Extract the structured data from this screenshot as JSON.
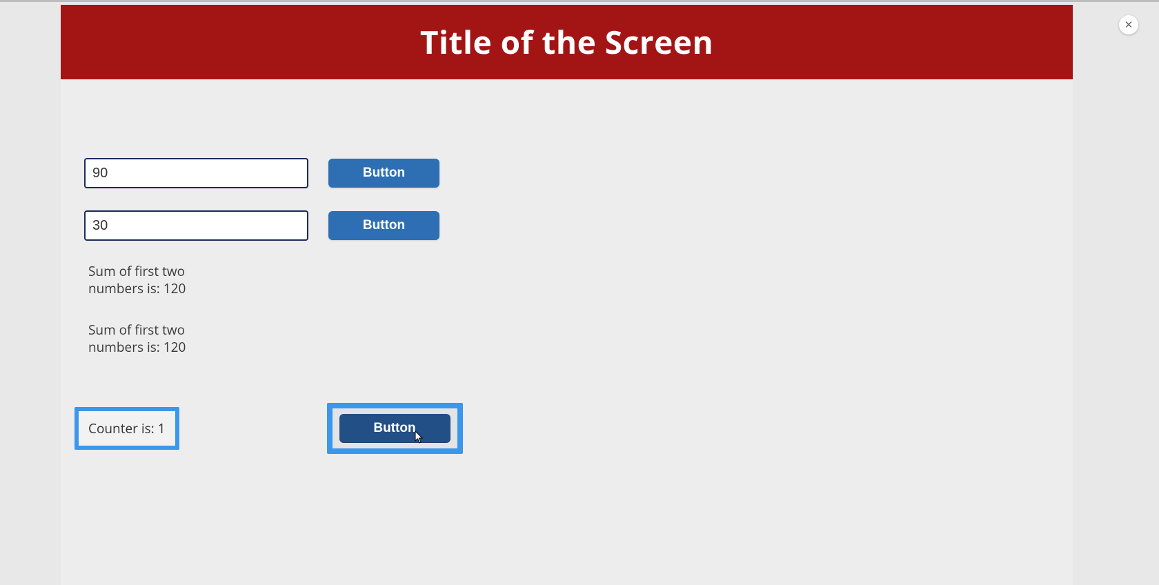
{
  "header": {
    "title": "Title of the Screen"
  },
  "close": {
    "glyph": "✕"
  },
  "inputs": {
    "first": {
      "value": "90"
    },
    "second": {
      "value": "30"
    }
  },
  "buttons": {
    "first_label": "Button",
    "second_label": "Button",
    "counter_label": "Button"
  },
  "sums": {
    "line1": "Sum of first two numbers is: 120",
    "line2": "Sum of first two numbers is: 120"
  },
  "counter": {
    "text": "Counter is: 1"
  }
}
